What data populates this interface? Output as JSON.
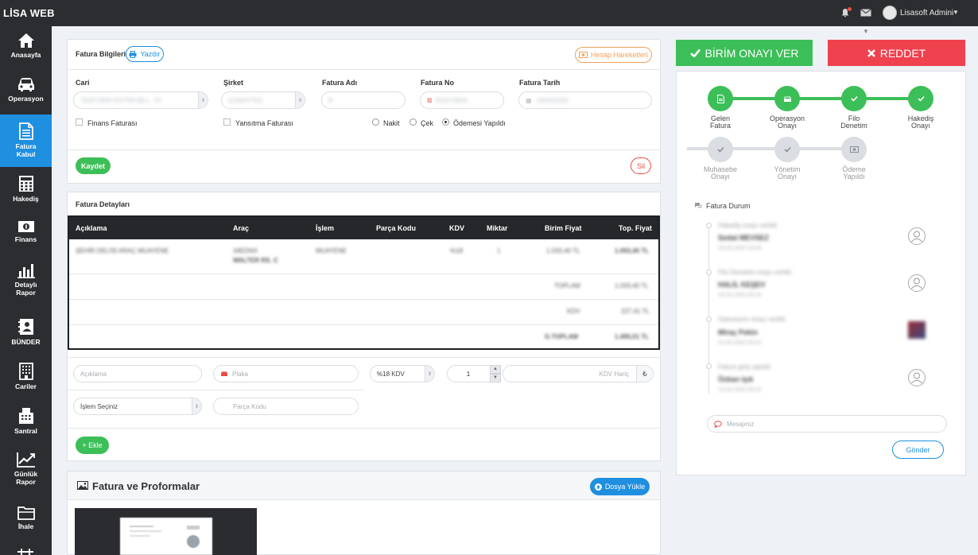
{
  "app": {
    "brand": "LİSA WEB"
  },
  "user": {
    "name": "Lisasoft Admini"
  },
  "sidebar": {
    "items": [
      {
        "label": "Anasayfa",
        "icon": "home-icon"
      },
      {
        "label": "Operasyon",
        "icon": "car-icon"
      },
      {
        "label": "Fatura",
        "label2": "Kabul",
        "icon": "document-icon",
        "active": true
      },
      {
        "label": "Hakediş",
        "icon": "calculator-icon"
      },
      {
        "label": "Finans",
        "icon": "money-icon"
      },
      {
        "label": "Detaylı",
        "label2": "Rapor",
        "icon": "bar-chart-icon"
      },
      {
        "label": "BÜNDER",
        "icon": "contact-book-icon"
      },
      {
        "label": "Cariler",
        "icon": "building-icon"
      },
      {
        "label": "Santral",
        "icon": "fax-icon"
      },
      {
        "label": "Günlük",
        "label2": "Rapor",
        "icon": "line-chart-icon"
      },
      {
        "label": "İhale",
        "icon": "folder-icon"
      }
    ]
  },
  "invoice": {
    "title": "Fatura Bilgileri",
    "print_label": "Yazdır",
    "account_moves_label": "Hesap Hareketleri",
    "fields": {
      "cari_label": "Cari",
      "cari_value": "TEKFORM EĞİTİM BİLL. TK",
      "sirket_label": "Şirket",
      "sirket_value": "GUNAYTAŞ",
      "fatura_adi_label": "Fatura Adı",
      "fatura_adi_value": "B",
      "fatura_no_label": "Fatura No",
      "fatura_no_value": "202073004",
      "fatura_tarih_label": "Fatura Tarih",
      "fatura_tarih_value": "14/04/2020"
    },
    "finans_faturasi": "Finans Faturası",
    "yansitma_faturasi": "Yansıtma Faturası",
    "payment_options": [
      "Nakit",
      "Çek",
      "Ödemesi Yapıldı"
    ],
    "payment_selected": "Ödemesi Yapıldı",
    "save_label": "Kaydet",
    "delete_label": "Sil"
  },
  "details": {
    "title": "Fatura Detayları",
    "columns": [
      "Açıklama",
      "Araç",
      "İşlem",
      "Parça Kodu",
      "KDV",
      "Miktar",
      "Birim Fiyat",
      "Top. Fiyat"
    ],
    "row": {
      "aciklama": "ŞEHİR DELİSİ ARAÇ MUAYENE",
      "arac1": "34EDNX",
      "arac2": "WALTER RS. C",
      "islem": "MUAYENE",
      "kdv": "%18",
      "miktar": "1",
      "birim": "1.033,40 TL",
      "toplam": "1.093,40 TL"
    },
    "totals": [
      {
        "label": "TOPLAM",
        "value": "1.033,40 TL"
      },
      {
        "label": "KDV",
        "value": "227,41 TL"
      },
      {
        "label": "G.TOPLAM",
        "value": "1.490,01 TL"
      }
    ]
  },
  "entry": {
    "aciklama_placeholder": "Açıklama",
    "plaka_placeholder": "Plaka",
    "kdv_value": "%18 KDV",
    "miktar_value": "1",
    "kdv_haric_placeholder": "KDV Hariç",
    "currency": "₺",
    "islem_value": "İşlem Seçiniz",
    "parca_placeholder": "Parça Kodu",
    "add_label": "+ Ekle"
  },
  "files": {
    "title": "Fatura ve Proformalar",
    "upload_label": "Dosya Yükle"
  },
  "actions": {
    "approve_label": "BİRİM ONAYI VER",
    "reject_label": "REDDET"
  },
  "workflow": {
    "steps": [
      {
        "label1": "Gelen",
        "label2": "Fatura",
        "done": true
      },
      {
        "label1": "Operasyon",
        "label2": "Onayı",
        "done": true
      },
      {
        "label1": "Filo",
        "label2": "Denetim",
        "done": true
      },
      {
        "label1": "Hakediş",
        "label2": "Onayı",
        "done": true
      },
      {
        "label1": "Muhasebe",
        "label2": "Onayı",
        "done": false
      },
      {
        "label1": "Yönetim",
        "label2": "Onayı",
        "done": false
      },
      {
        "label1": "Ödeme",
        "label2": "Yapıldı",
        "done": false
      }
    ]
  },
  "status": {
    "title": "Fatura Durum",
    "entries": [
      {
        "event": "Hakediş onayı verildi.",
        "person": "Sedat MEVSEZ",
        "date": "16.04.2020 10:05"
      },
      {
        "event": "Filo Denetimi onayı verildi.",
        "person": "HALİL KEŞEV",
        "date": "16.04.2020 09:16"
      },
      {
        "event": "Operasyon onayı verildi.",
        "person": "Miraç Pekin",
        "date": "15.04.2020 09:22"
      },
      {
        "event": "Fatura giriş yapıldı.",
        "person": "Özkan Işık",
        "date": "15.04.2020 09:16"
      }
    ],
    "message_placeholder": "Mesajınız",
    "send_label": "Gönder"
  }
}
